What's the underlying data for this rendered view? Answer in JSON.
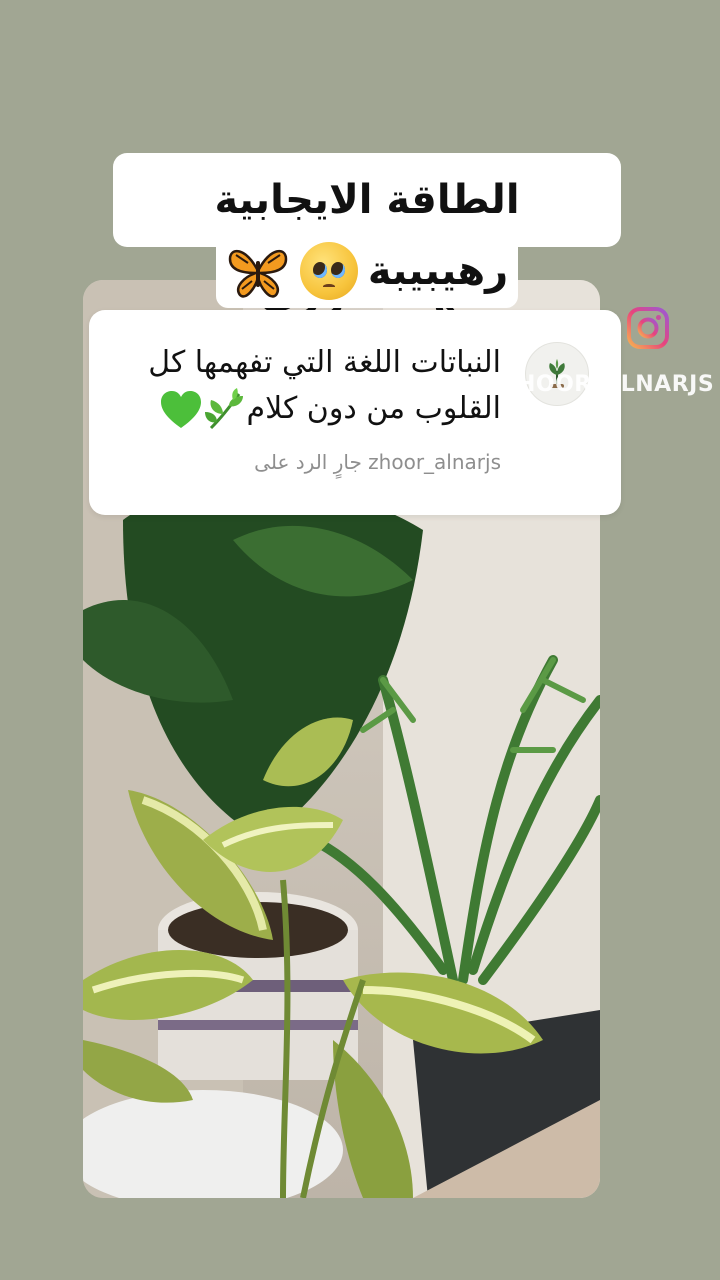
{
  "sticker": {
    "title_line1": "الطاقة الايجابية بهالستوري",
    "title_line2": "رهيبيبة"
  },
  "reply": {
    "line1": "النباتات اللغة التي تفهمها كل",
    "line2": "القلوب من دون كلام",
    "meta": "جارٍ الرد على zhoor_alnarjs"
  },
  "watermark": {
    "handle": "@ZHOOR_ALNARJS",
    "icon": "instagram-icon"
  },
  "icons": {
    "title_emojis": [
      "pleading-face-icon",
      "butterfly-icon"
    ],
    "reply_emojis": [
      "herb-icon",
      "green-heart-icon"
    ],
    "avatar": "plant-logo-icon"
  },
  "colors": {
    "background": "#a1a693",
    "card": "#ffffff",
    "meta_text": "#8e8e8e",
    "heart": "#4cbf3a"
  }
}
